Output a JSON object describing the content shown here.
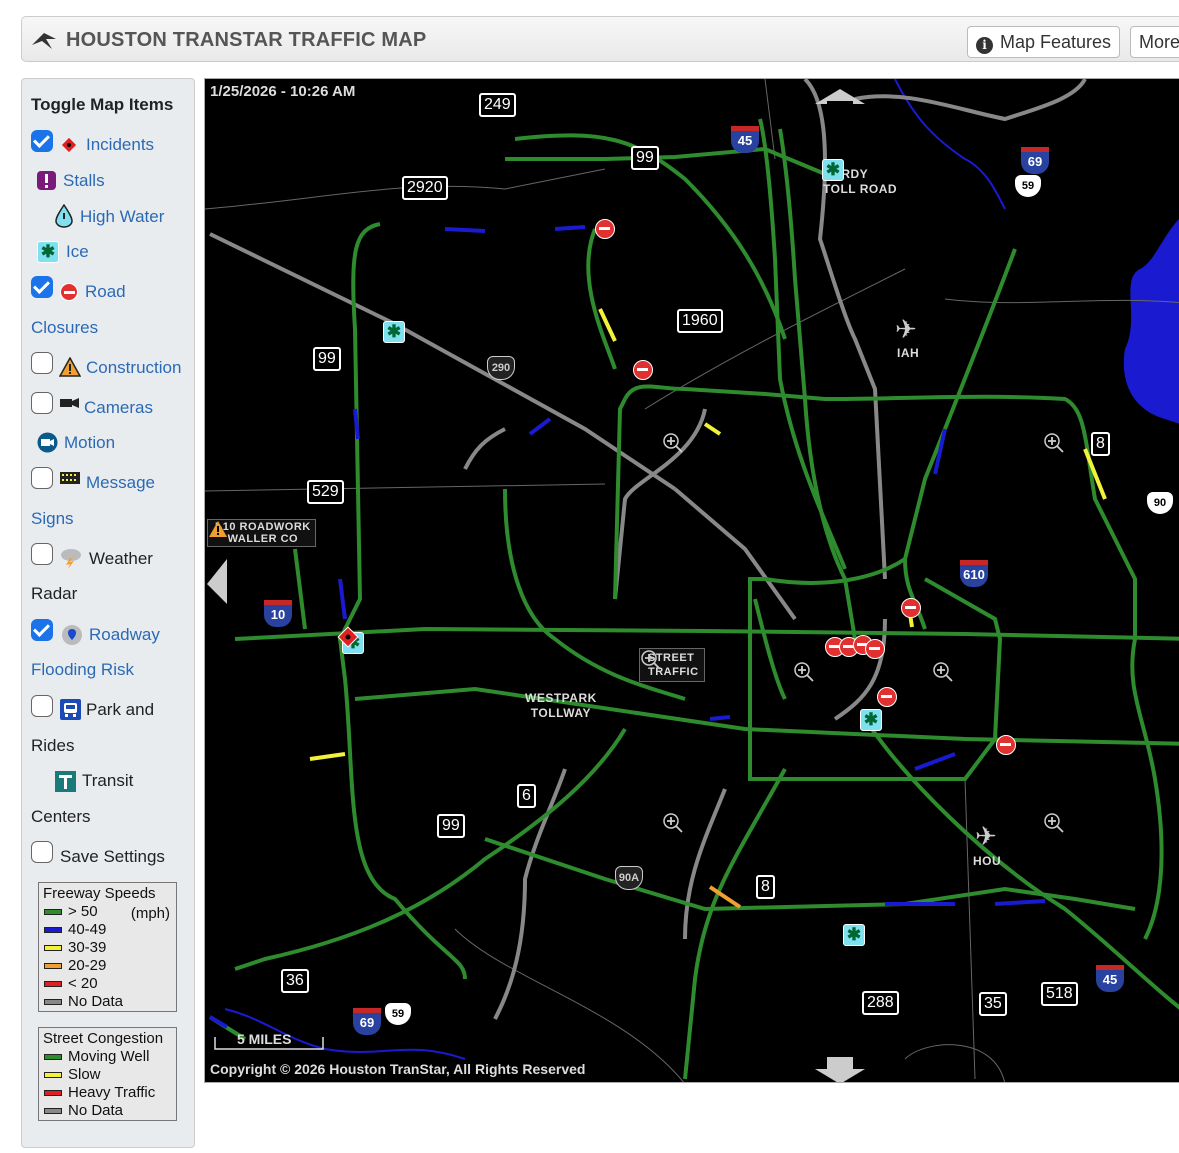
{
  "header": {
    "title": "HOUSTON TRANSTAR TRAFFIC MAP",
    "map_features_label": "Map Features",
    "more_label": "More"
  },
  "sidebar": {
    "title": "Toggle Map Items",
    "items": [
      {
        "label": "Incidents",
        "checked": true
      },
      {
        "label": "Stalls"
      },
      {
        "label": "High Water"
      },
      {
        "label": "Ice"
      },
      {
        "label": "Road",
        "label2": "Closures",
        "checked": true
      },
      {
        "label": "Construction",
        "checked": false
      },
      {
        "label": "Cameras",
        "checked": false
      },
      {
        "label": "Motion"
      },
      {
        "label": "Message",
        "label2": "Signs",
        "checked": false
      },
      {
        "label": "Weather",
        "label2": "Radar",
        "checked": false
      },
      {
        "label": "Roadway",
        "label2": "Flooding Risk",
        "checked": true
      },
      {
        "label": "Park and",
        "label2": "Rides",
        "checked": false
      },
      {
        "label": "Transit",
        "label2": "Centers"
      },
      {
        "label": "Save Settings",
        "checked": false
      }
    ]
  },
  "legend_speeds": {
    "title": "Freeway Speeds",
    "unit": "(mph)",
    "rows": [
      {
        "label": "> 50",
        "color": "#2e8b2e"
      },
      {
        "label": "40-49",
        "color": "#1a1ad0"
      },
      {
        "label": "30-39",
        "color": "#f2f23a"
      },
      {
        "label": "20-29",
        "color": "#f0a030"
      },
      {
        "label": "< 20",
        "color": "#e02020"
      },
      {
        "label": "No Data",
        "color": "#888888"
      }
    ]
  },
  "legend_street": {
    "title": "Street Congestion",
    "rows": [
      {
        "label": "Moving Well",
        "color": "#2e8b2e"
      },
      {
        "label": "Slow",
        "color": "#f2f23a"
      },
      {
        "label": "Heavy Traffic",
        "color": "#e02020"
      },
      {
        "label": "No Data",
        "color": "#888888"
      }
    ]
  },
  "map": {
    "timestamp": "1/25/2026 - 10:26 AM",
    "copyright": "Copyright © 2026 Houston TranStar, All Rights Reserved",
    "scale_label": "5 MILES",
    "roadwork_label": "I-10 ROADWORK",
    "roadwork_label2": "WALLER CO",
    "hardy_label": "HARDY",
    "hardy_label2": "TOLL ROAD",
    "westpark_label": "WESTPARK",
    "westpark_label2": "TOLLWAY",
    "street_label": "STREET",
    "street_label2": "TRAFFIC",
    "iah_label": "IAH",
    "hou_label": "HOU",
    "shields": {
      "s249": "249",
      "s99a": "99",
      "s2920": "2920",
      "s1960": "1960",
      "s99b": "99",
      "s529": "529",
      "s8a": "8",
      "s6": "6",
      "s99c": "99",
      "s8b": "8",
      "s36": "36",
      "s288": "288",
      "s35": "35",
      "s518": "518"
    },
    "interstates": {
      "i45a": "45",
      "i69a": "69",
      "i610": "610",
      "i10": "10",
      "i69b": "69",
      "i45b": "45"
    },
    "us_routes": {
      "u59a": "59",
      "u290": "290",
      "u90": "90",
      "u90a": "90A",
      "u59b": "59"
    }
  }
}
